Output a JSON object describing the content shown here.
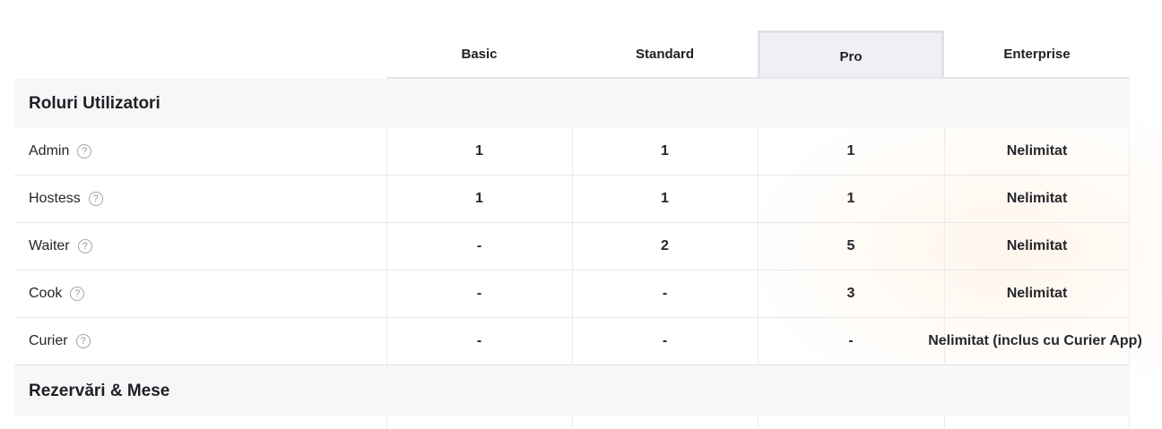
{
  "plans": [
    {
      "name": "Basic"
    },
    {
      "name": "Standard"
    },
    {
      "name": "Pro"
    },
    {
      "name": "Enterprise"
    }
  ],
  "highlighted_plan": "Pro",
  "sections": [
    {
      "title": "Roluri Utilizatori",
      "rows": [
        {
          "label": "Admin",
          "help_icon": "question-circle-icon",
          "values": [
            "1",
            "1",
            "1",
            "Nelimitat"
          ]
        },
        {
          "label": "Hostess",
          "help_icon": "question-circle-icon",
          "values": [
            "1",
            "1",
            "1",
            "Nelimitat"
          ]
        },
        {
          "label": "Waiter",
          "help_icon": "question-circle-icon",
          "values": [
            "-",
            "2",
            "5",
            "Nelimitat"
          ]
        },
        {
          "label": "Cook",
          "help_icon": "question-circle-icon",
          "values": [
            "-",
            "-",
            "3",
            "Nelimitat"
          ]
        },
        {
          "label": "Curier",
          "help_icon": "question-circle-icon",
          "values": [
            "-",
            "-",
            "-",
            "Nelimitat (inclus cu Curier App)"
          ]
        }
      ]
    },
    {
      "title": "Rezervări & Mese",
      "rows": []
    }
  ],
  "help_glyph": "?"
}
